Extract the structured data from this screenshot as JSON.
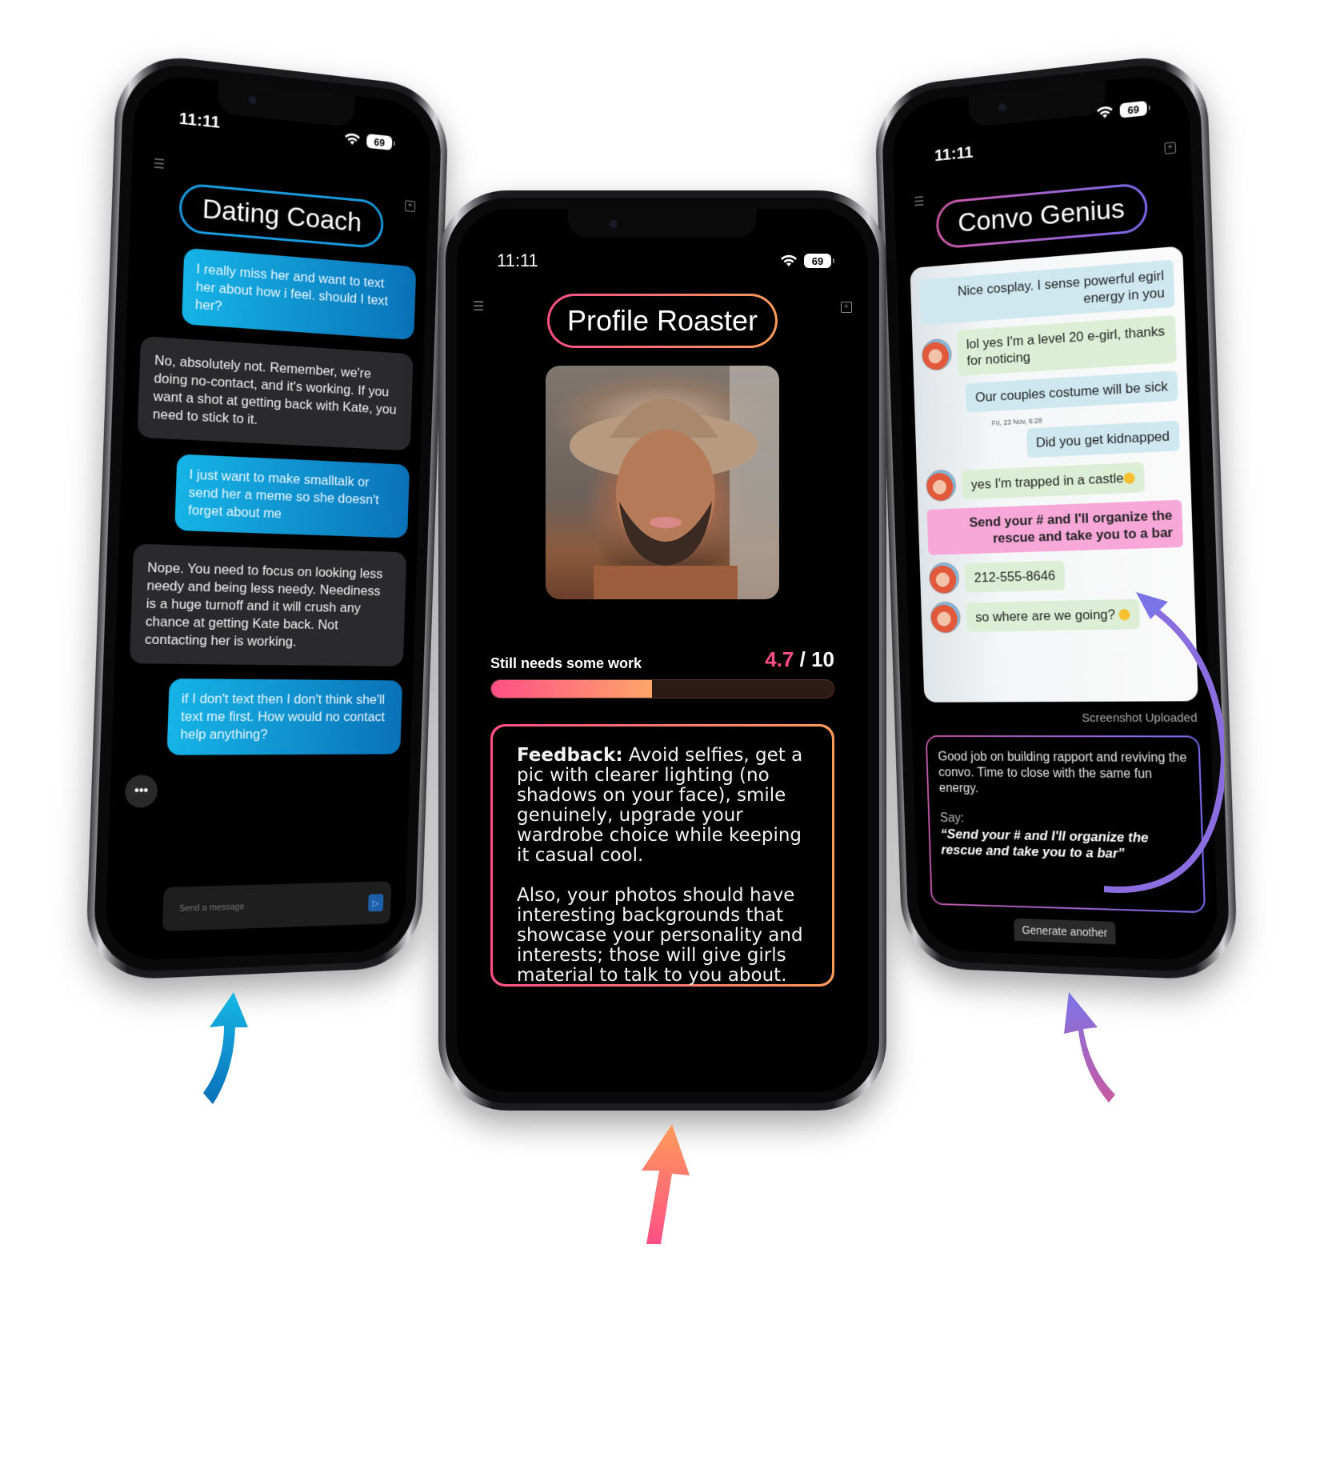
{
  "status_bar": {
    "time": "11:11",
    "battery": "69"
  },
  "phones": {
    "dating_coach": {
      "title": "Dating Coach",
      "accent": "#1a9ce0",
      "messages": [
        {
          "role": "user",
          "text": "I really miss her and want to text her about how i feel. should I text her?"
        },
        {
          "role": "bot",
          "text": "No, absolutely not. Remember, we're doing no-contact, and it's working. If you want a shot at getting back with Kate, you need to stick to it."
        },
        {
          "role": "user",
          "text": "I just want to make smalltalk or send her a meme so she doesn't forget about me"
        },
        {
          "role": "bot",
          "text": "Nope. You need to focus on looking less needy and being less needy. Neediness is a huge turnoff and it will crush any chance at getting Kate back. Not contacting her is working."
        },
        {
          "role": "user",
          "text": "if I don't text then I don't think she'll text me first. How would no contact help anything?"
        }
      ],
      "typing_indicator": "•••",
      "composer": {
        "placeholder": "Send a message",
        "value": ""
      }
    },
    "profile_roaster": {
      "title": "Profile Roaster",
      "accent_start": "#ff4f86",
      "accent_end": "#ff9c5a",
      "photo_alt": "Man in straw bucket hat selfie",
      "score_label": "Still needs some work",
      "score": "4.7",
      "score_max": " / 10",
      "score_fraction": 0.47,
      "feedback_heading": "Feedback:",
      "feedback_p1": " Avoid selfies, get a pic with clearer lighting (no shadows on your face), smile genuinely, upgrade your wardrobe choice while keeping it casual cool.",
      "feedback_p2": "Also, your photos should have interesting backgrounds that showcase your personality and interests; those will give girls material to talk to you about."
    },
    "convo_genius": {
      "title": "Convo Genius",
      "accent_start": "#d05aa8",
      "accent_end": "#7a6cf0",
      "screenshot_messages": [
        {
          "dir": "out",
          "text": "Nice cosplay. I sense powerful egirl energy in you"
        },
        {
          "dir": "in",
          "text": "lol yes I'm a level 20 e-girl, thanks for noticing"
        },
        {
          "dir": "out",
          "text": "Our couples costume will be sick"
        },
        {
          "dir": "time",
          "text": "Fri, 23 Nov, 6:28"
        },
        {
          "dir": "out",
          "text": "Did you get kidnapped"
        },
        {
          "dir": "in",
          "text": "yes I'm trapped in a castle"
        },
        {
          "dir": "hl",
          "text": "Send your # and I'll organize the rescue and take you to a bar"
        },
        {
          "dir": "in",
          "text": "212-555-8646"
        },
        {
          "dir": "in",
          "text": "so where are we going?"
        }
      ],
      "uploaded_label": "Screenshot Uploaded",
      "advice": "Good job on building rapport and reviving the convo. Time to close with the same fun energy.",
      "say_label": "Say:",
      "say_quote": "“Send your # and I'll organize the rescue and take you to a bar”",
      "generate_button": "Generate another"
    }
  },
  "arrows": {
    "left_color": [
      "#0a6fb8",
      "#16b8e6"
    ],
    "center_color": [
      "#ff4f86",
      "#ff9c5a"
    ],
    "right_color": [
      "#c85aa0",
      "#7a74e8"
    ]
  }
}
